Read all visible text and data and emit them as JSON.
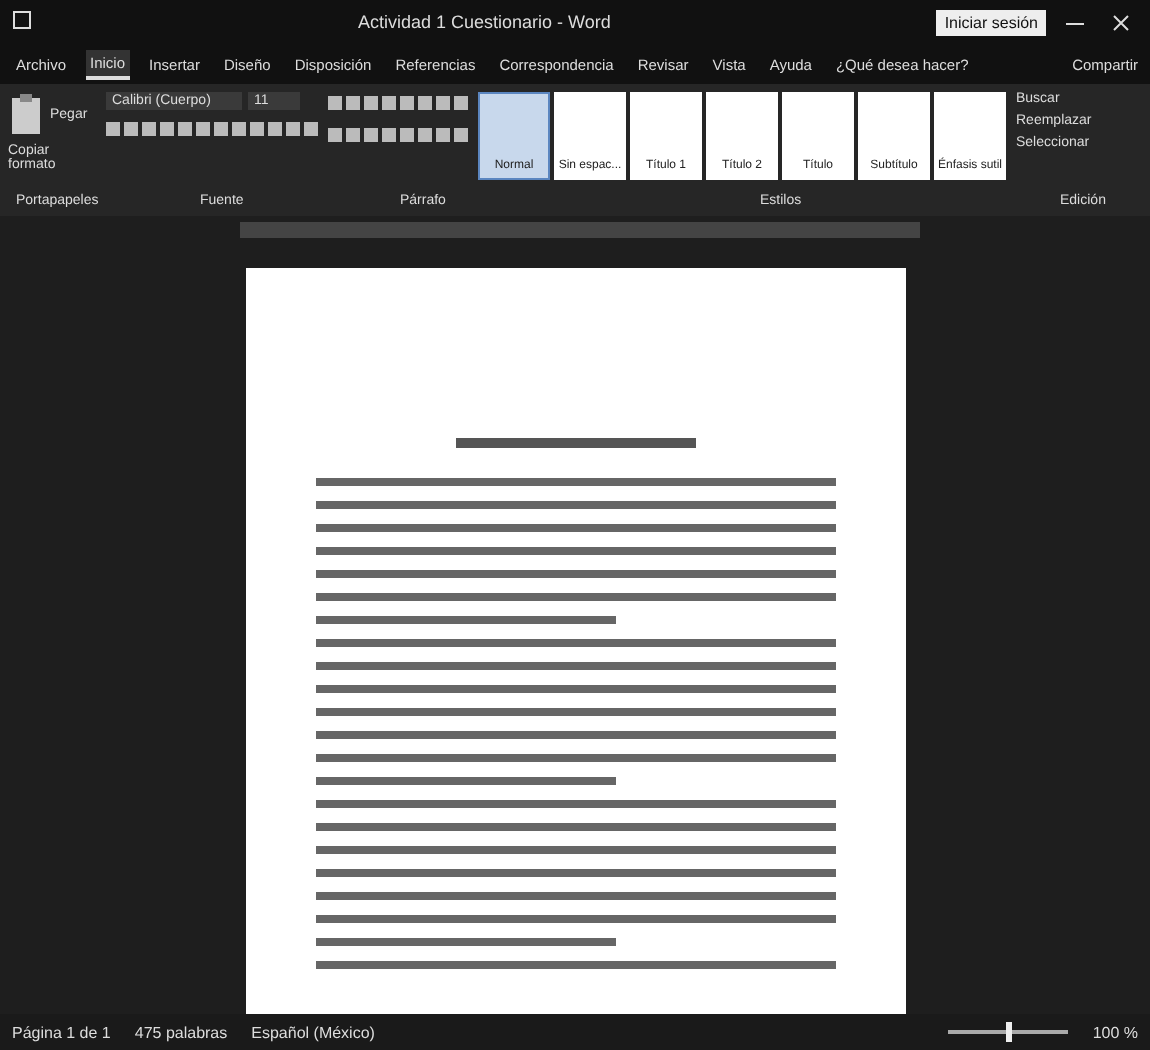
{
  "window": {
    "title": "Actividad 1 Cuestionario - Word",
    "account_button": "Iniciar sesión"
  },
  "tabs": [
    {
      "label": "Archivo",
      "selected": false
    },
    {
      "label": "Inicio",
      "selected": true
    },
    {
      "label": "Insertar",
      "selected": false
    },
    {
      "label": "Diseño",
      "selected": false
    },
    {
      "label": "Disposición",
      "selected": false
    },
    {
      "label": "Referencias",
      "selected": false
    },
    {
      "label": "Correspondencia",
      "selected": false
    },
    {
      "label": "Revisar",
      "selected": false
    },
    {
      "label": "Vista",
      "selected": false
    },
    {
      "label": "Ayuda",
      "selected": false
    },
    {
      "label": "¿Qué desea hacer?",
      "selected": false
    }
  ],
  "share": "Compartir",
  "ribbon": {
    "paste": "Pegar",
    "format_painter": "Copiar formato",
    "font": "Calibri (Cuerpo)",
    "size": "11",
    "styles": [
      {
        "label": "Normal",
        "selected": true
      },
      {
        "label": "Sin espac...",
        "selected": false
      },
      {
        "label": "Título 1",
        "selected": false
      },
      {
        "label": "Título 2",
        "selected": false
      },
      {
        "label": "Título",
        "selected": false
      },
      {
        "label": "Subtítulo",
        "selected": false
      },
      {
        "label": "Énfasis sutil",
        "selected": false
      }
    ],
    "editing": [
      "Buscar",
      "Reemplazar",
      "Seleccionar"
    ],
    "groups": [
      "Portapapeles",
      "Fuente",
      "Párrafo",
      "Estilos",
      "Edición"
    ]
  },
  "status_bar": {
    "page": "Página 1 de 1",
    "words": "475 palabras",
    "language": "Español (México)",
    "zoom": {
      "level": 0.5,
      "reading": "100 %"
    }
  }
}
